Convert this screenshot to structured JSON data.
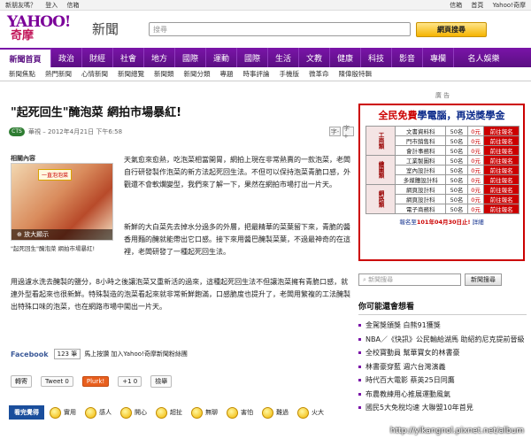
{
  "topbar": {
    "left": [
      "新朋友嗎？",
      "登入",
      "信箱"
    ],
    "right": [
      "信箱",
      "首頁",
      "Yahoo!奇摩"
    ]
  },
  "brand": {
    "logo_text": "YAHOO!",
    "logo_sub": "奇摩",
    "section": "新聞"
  },
  "search": {
    "placeholder": "搜尋",
    "button": "網頁搜尋"
  },
  "nav": [
    "新聞首頁",
    "政治",
    "財經",
    "社會",
    "地方",
    "國際",
    "運動",
    "國際",
    "生活",
    "文教",
    "健康",
    "科技",
    "影音",
    "專欄",
    "名人娛樂"
  ],
  "subnav": [
    "新聞焦點",
    "熱門新聞",
    "心情新聞",
    "新聞總覽",
    "新聞類",
    "新聞分類",
    "專題",
    "時事評論",
    "手機版",
    "微革命",
    "陳偉殷特輯"
  ],
  "article": {
    "headline": "\"起死回生\"醃泡菜 網拍市場暴紅!",
    "source_badge": "CTS",
    "byline": "華視 – 2012年4月21日 下午6:58",
    "font_small": "字-",
    "font_large": "字+",
    "related_label": "相關內容",
    "photo_tag": "一直泡泡菜",
    "photo_zoom": "放大顯示",
    "photo_caption": "\"起死回生\"醃泡菜 網拍市場暴紅!",
    "paragraphs": [
      "天氣愈來愈熱，吃泡菜相當開胃，網拍上現在非常熱賣的一款泡菜，老闆自行研發製作泡菜的新方法起死回生法。不但可以保持泡菜青脆口感，外觀還不會軟爛變型，我們來了解一下，果然在網拍市場打出一片天。",
      "新鮮的大白菜先去掉水分過多的外層，把最精華的菜葉留下來，青脆的醬香用麵的醃就能帶出它口感。接下來用醬巴醃製菜葉，不過最神奇的在這裡，老闆研發了一種起死回生法。",
      "用過濾水洗去醃製的鹽分，8小時之後讓泡菜又重新活的過來，這種起死回生法不但讓泡菜擁有青脆口感，就連外型看起來也很新鮮。特殊製造的泡菜看起來就非常新鮮飽滿，口感脆度也提升了，老闆用繁複的工法醃製出特殊口味的泡菜，也在網路市場中闖出一片天。"
    ]
  },
  "social": {
    "facebook": "Facebook",
    "count": "123 筆",
    "text": "馬上按讚 加入Yahoo!奇摩新聞粉絲團"
  },
  "share": [
    "轉寄",
    "Tweet 0",
    "Plurk!",
    "+1 0",
    "檢舉"
  ],
  "mood": {
    "title": "看完覺得",
    "items": [
      "實用",
      "感人",
      "開心",
      "超扯",
      "無聊",
      "害怕",
      "難過",
      "火大"
    ]
  },
  "sidebar": {
    "ad_label": "廣 告",
    "ad_title_a": "全民免費",
    "ad_title_b": "學電腦，再送獎學金",
    "ad_rows": [
      [
        "工商類",
        "文書資料科",
        "50名",
        "0元",
        "前往報名"
      ],
      [
        "",
        "門市銷售科",
        "50名",
        "0元",
        "前往報名"
      ],
      [
        "",
        "會計事務科",
        "50名",
        "0元",
        "前往報名"
      ],
      [
        "繪圖類",
        "工業製圖科",
        "50名",
        "0元",
        "前往報名"
      ],
      [
        "",
        "室內設計科",
        "50名",
        "0元",
        "前往報名"
      ],
      [
        "",
        "多媒體設計科",
        "50名",
        "0元",
        "前往報名"
      ],
      [
        "網路類",
        "網頁設計科",
        "50名",
        "0元",
        "前往報名"
      ],
      [
        "",
        "網頁設計科",
        "50名",
        "0元",
        "前往報名"
      ],
      [
        "",
        "電子商務科",
        "50名",
        "0元",
        "前往報名"
      ]
    ],
    "ad_foot_a": "報名至",
    "ad_foot_b": "101年04月30日止!",
    "ad_foot_c": "詳細",
    "search_placeholder": "新聞搜尋",
    "search_button": "新聞搜尋",
    "list_title": "你可能還會想看",
    "list": [
      "金駕獎頒獎 白熊91獲獎",
      "NBA／《快訊》公民輸給湖馬 助紹約尼克提前晉級",
      "全校寶動員 幫華寶女的林書豪",
      "林書豪穿藍 週六台灣演義",
      "時代百大電影 蔡英25日同鷹",
      "布農教練用心推展運動風氣",
      "國民5大免稅均速 大聯盟10年首見"
    ]
  },
  "watermark": "http://yikangnol.pixnet.net/album"
}
